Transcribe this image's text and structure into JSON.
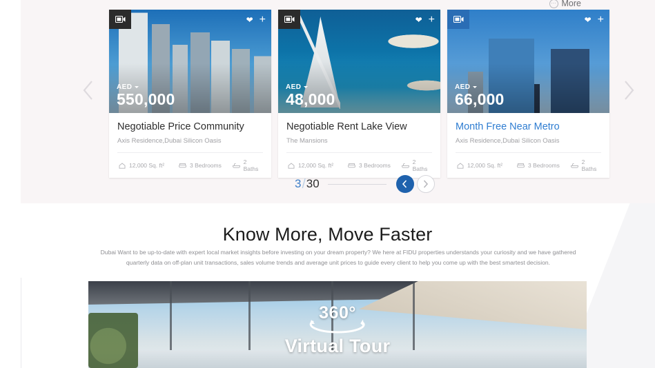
{
  "top_bar": {
    "more_label": "More",
    "more_icon": "more-circle-icon"
  },
  "carousel": {
    "prev_icon": "chevron-left-icon",
    "next_icon": "chevron-right-icon",
    "cards": [
      {
        "badge_icon": "video-camera-icon",
        "badge_style": "dark",
        "favorite_icon": "heart-icon",
        "add_icon": "plus-icon",
        "currency": "AED",
        "price": "550,000",
        "title": "Negotiable Price Community",
        "subtitle": "Axis Residence,Dubai Silicon Oasis",
        "title_is_link": false,
        "features": [
          {
            "icon": "home-area-icon",
            "label": "12,000 Sq. ft²"
          },
          {
            "icon": "bed-icon",
            "label": "3 Bedrooms"
          },
          {
            "icon": "bath-icon",
            "label": "2 Baths"
          }
        ]
      },
      {
        "badge_icon": "video-camera-icon",
        "badge_style": "dark",
        "favorite_icon": "heart-icon",
        "add_icon": "plus-icon",
        "currency": "AED",
        "price": "48,000",
        "title": "Negotiable Rent Lake View",
        "subtitle": "The Mansions",
        "title_is_link": false,
        "features": [
          {
            "icon": "home-area-icon",
            "label": "12,000 Sq. ft²"
          },
          {
            "icon": "bed-icon",
            "label": "3 Bedrooms"
          },
          {
            "icon": "bath-icon",
            "label": "2 Baths"
          }
        ]
      },
      {
        "badge_icon": "video-camera-icon",
        "badge_style": "blue",
        "favorite_icon": "heart-icon",
        "add_icon": "plus-icon",
        "currency": "AED",
        "price": "66,000",
        "title": "Month Free Near Metro",
        "subtitle": "Axis Residence,Dubai Silicon Oasis",
        "title_is_link": true,
        "features": [
          {
            "icon": "home-area-icon",
            "label": "12,000 Sq. ft²"
          },
          {
            "icon": "bed-icon",
            "label": "3 Bedrooms"
          },
          {
            "icon": "bath-icon",
            "label": "2 Baths"
          }
        ]
      }
    ]
  },
  "pagination": {
    "current": "3",
    "separator": "/",
    "total": "30",
    "prev_icon": "chevron-left-icon",
    "next_icon": "chevron-right-icon"
  },
  "know_section": {
    "title": "Know More, Move Faster",
    "paragraph": "Dubai Want to be up-to-date with expert local market insights before investing on your dream property? We here at FIDU properties understands your curiosity and we have gathered quarterly data on off-plan unit transactions, sales volume trends and average unit prices to guide every client to help you come up with the best smartest decision.",
    "hero": {
      "degrees_label": "360°",
      "tour_label": "Virtual Tour",
      "rotate_icon": "rotate-360-icon"
    }
  },
  "colors": {
    "band_background": "#f9f5f6",
    "accent_blue": "#2f7dd1",
    "pagination_active": "#1f62ad",
    "page_background": "#ffffff",
    "diagonal_panel": "#f5f5f7"
  }
}
